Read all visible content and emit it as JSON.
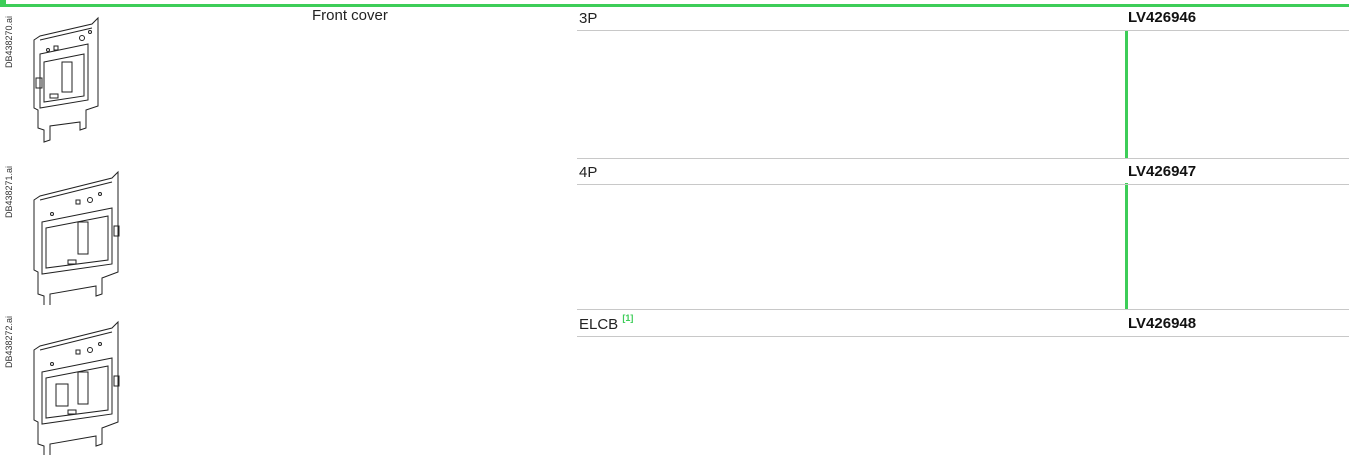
{
  "component": {
    "label": "Front cover"
  },
  "figures": [
    {
      "id": "DB438270.ai"
    },
    {
      "id": "DB438271.ai"
    },
    {
      "id": "DB438272.ai"
    }
  ],
  "rows": [
    {
      "description": "3P",
      "note": "",
      "reference": "LV426946"
    },
    {
      "description": "4P",
      "note": "",
      "reference": "LV426947"
    },
    {
      "description": "ELCB",
      "note": "[1]",
      "reference": "LV426948"
    }
  ],
  "colors": {
    "accent": "#3dcd58",
    "rule": "#c8c8c8"
  }
}
